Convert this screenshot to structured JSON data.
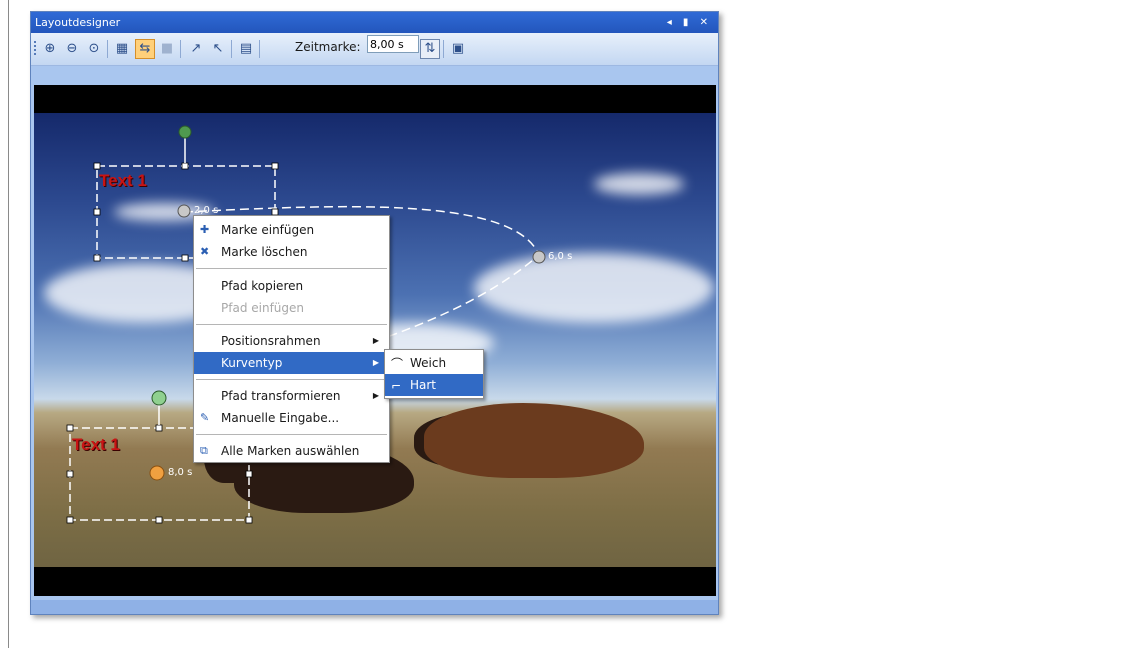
{
  "window": {
    "title": "Layoutdesigner",
    "controls": "◂ ▮ ✕"
  },
  "toolbar": {
    "timestamp_label": "Zeitmarke:",
    "timestamp_value": "8,00 s"
  },
  "stage": {
    "caption_top": "Text 1",
    "caption_bottom": "Text 1",
    "mark_top": "2,0 s",
    "mark_right": "6,0 s",
    "mark_bottom": "8,0 s"
  },
  "context_menu": {
    "items": [
      {
        "label": "Marke einfügen",
        "icon": "insert-mark-icon"
      },
      {
        "label": "Marke löschen",
        "icon": "delete-mark-icon"
      },
      {
        "label": "Pfad kopieren"
      },
      {
        "label": "Pfad einfügen",
        "disabled": true
      },
      {
        "label": "Positionsrahmen",
        "submenu": true
      },
      {
        "label": "Kurventyp",
        "submenu": true,
        "selected": true
      },
      {
        "label": "Pfad transformieren",
        "submenu": true
      },
      {
        "label": "Manuelle Eingabe...",
        "icon": "manual-input-icon"
      },
      {
        "label": "Alle Marken auswählen",
        "icon": "select-all-marks-icon"
      }
    ]
  },
  "submenu": {
    "items": [
      {
        "label": "Weich",
        "icon": "curve-smooth-icon"
      },
      {
        "label": "Hart",
        "icon": "curve-hard-icon",
        "selected": true
      }
    ]
  },
  "colors": {
    "titlebar": "#2a60c8",
    "selection": "#316ac5",
    "caption": "#c81414",
    "active_button": "#ffd07a"
  }
}
